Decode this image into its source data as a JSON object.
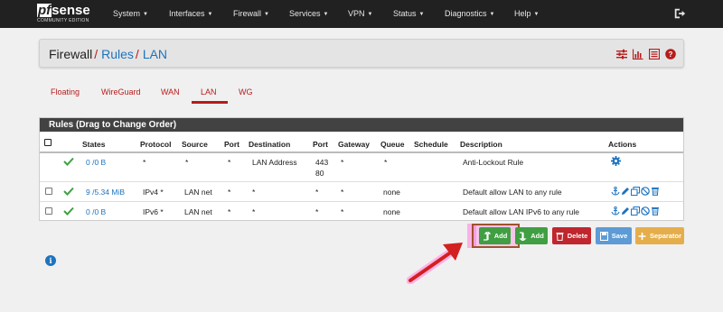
{
  "logo": {
    "mark": "sense",
    "pf": "pf",
    "subtitle": "COMMUNITY EDITION"
  },
  "nav": [
    {
      "label": "System"
    },
    {
      "label": "Interfaces"
    },
    {
      "label": "Firewall"
    },
    {
      "label": "Services"
    },
    {
      "label": "VPN"
    },
    {
      "label": "Status"
    },
    {
      "label": "Diagnostics"
    },
    {
      "label": "Help"
    }
  ],
  "breadcrumb": {
    "root": "Firewall",
    "sep": "/",
    "rules": "Rules",
    "lan": "LAN"
  },
  "tabs": [
    {
      "label": "Floating"
    },
    {
      "label": "WireGuard"
    },
    {
      "label": "WAN"
    },
    {
      "label": "LAN",
      "active": true
    },
    {
      "label": "WG"
    }
  ],
  "panel": {
    "title": "Rules (Drag to Change Order)"
  },
  "columns": {
    "states": "States",
    "protocol": "Protocol",
    "source": "Source",
    "port": "Port",
    "destination": "Destination",
    "dport": "Port",
    "gateway": "Gateway",
    "queue": "Queue",
    "schedule": "Schedule",
    "description": "Description",
    "actions": "Actions"
  },
  "rows": [
    {
      "states": "0 /0 B",
      "protocol": "*",
      "source": "*",
      "port": "*",
      "destination": "LAN Address",
      "dport1": "443",
      "dport2": "80",
      "gateway": "*",
      "queue": "*",
      "schedule": "",
      "description": "Anti-Lockout Rule"
    },
    {
      "states": "9 /5.34 MiB",
      "protocol": "IPv4 *",
      "source": "LAN net",
      "port": "*",
      "destination": "*",
      "dport1": "*",
      "gateway": "*",
      "queue": "none",
      "schedule": "",
      "description": "Default allow LAN to any rule"
    },
    {
      "states": "0 /0 B",
      "protocol": "IPv6 *",
      "source": "LAN net",
      "port": "*",
      "destination": "*",
      "dport1": "*",
      "gateway": "*",
      "queue": "none",
      "schedule": "",
      "description": "Default allow LAN IPv6 to any rule"
    }
  ],
  "buttons": {
    "add_top": "Add",
    "add_bottom": "Add",
    "delete": "Delete",
    "save": "Save",
    "separator": "Separator"
  },
  "colors": {
    "navbar": "#212121",
    "accent_red": "#b71c1c",
    "link_blue": "#1e73be",
    "success_green": "#3f9f42",
    "danger_red": "#c0262d",
    "save_blue": "#5c9bd5",
    "separator_orange": "#e5ae4b"
  },
  "icons": {
    "logout": "logout-icon",
    "breadcrumb": [
      "sliders-icon",
      "bar-chart-icon",
      "list-icon",
      "help-icon"
    ],
    "row_actions": [
      "anchor-icon",
      "pencil-icon",
      "copy-icon",
      "disable-icon",
      "trash-icon"
    ]
  }
}
